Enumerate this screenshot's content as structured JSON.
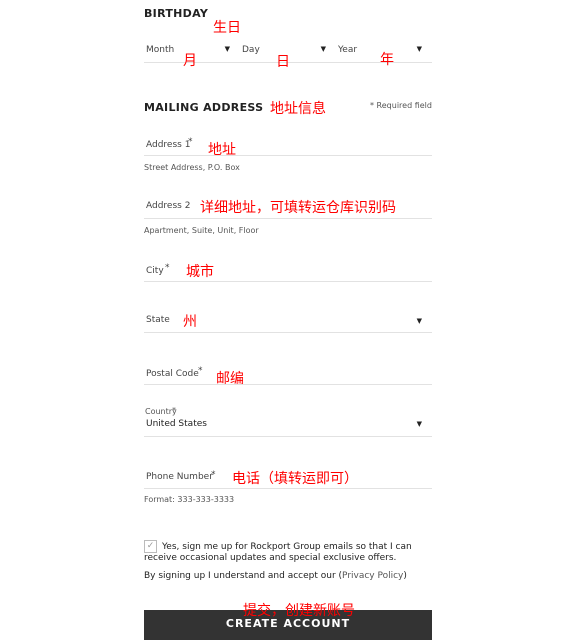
{
  "birthday": {
    "title": "BIRTHDAY",
    "month": "Month",
    "day": "Day",
    "year": "Year"
  },
  "mailing": {
    "title": "MAILING ADDRESS",
    "required_note": "* Required field",
    "address1": "Address 1",
    "address1_hint": "Street Address, P.O. Box",
    "address2": "Address 2",
    "address2_hint": "Apartment, Suite, Unit, Floor",
    "city": "City",
    "state": "State",
    "postal": "Postal Code",
    "country_label": "Country",
    "country_value": "United States",
    "phone": "Phone Number",
    "phone_hint": "Format: 333-333-3333",
    "asterisk": "*"
  },
  "consent": {
    "checked": true,
    "text1": "Yes, sign me up for Rockport Group emails so that I can",
    "text2": "receive occasional updates and special exclusive offers.",
    "policy_prefix": "By signing up I understand and accept our (",
    "policy_link": "Privacy Policy",
    "policy_suffix": ")"
  },
  "button": {
    "label": "CREATE ACCOUNT"
  },
  "annotations": {
    "birthday": "生日",
    "month": "月",
    "day": "日",
    "year": "年",
    "mailing": "地址信息",
    "address1": "地址",
    "address2": "详细地址，可填转运仓库识别码",
    "city": "城市",
    "state": "州",
    "postal": "邮编",
    "phone": "电话（填转运即可）",
    "submit": "提交，创建新账号"
  }
}
